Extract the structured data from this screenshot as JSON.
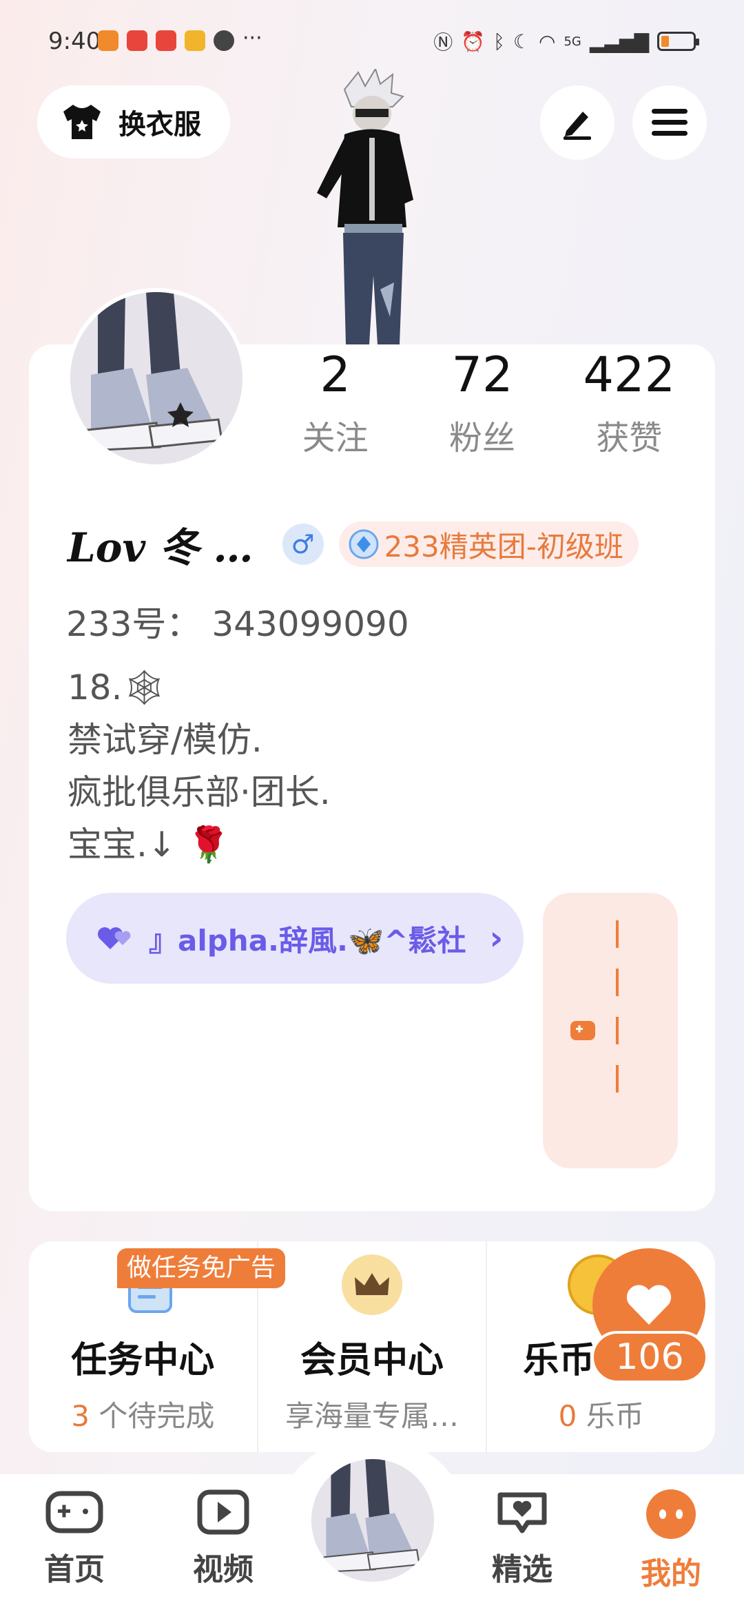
{
  "status": {
    "time": "9:40",
    "signal": "5G",
    "battery_level": 0.2,
    "app_icons": [
      "#f08a2a",
      "#e8453c",
      "#e8453c",
      "#f0b52a",
      "#444444"
    ]
  },
  "header": {
    "wardrobe_label": "换衣服",
    "edit_icon": "pen-icon",
    "menu_icon": "menu-icon"
  },
  "profile": {
    "stats": [
      {
        "value": "2",
        "label": "关注"
      },
      {
        "value": "72",
        "label": "粉丝"
      },
      {
        "value": "422",
        "label": "获赞"
      }
    ],
    "name": "Lov 冬 …",
    "gender": "♂",
    "badge": "233精英团-初级班",
    "id_label": "233号：",
    "id_value": "343099090",
    "bio": [
      "18.🕸",
      "禁试穿/模仿.",
      "疯批俱乐部·团长.",
      "宝宝.↓ 🌹"
    ],
    "club": "』alpha.辞風.🦋^鬆社",
    "club_arrow": "›"
  },
  "services": [
    {
      "title": "任务中心",
      "sub_prefix": "3",
      "sub_suffix": " 个待完成"
    },
    {
      "title": "会员中心",
      "sub_prefix": "",
      "sub_suffix": "享海量专属…"
    },
    {
      "title": "乐币",
      "sub_prefix": "0",
      "sub_suffix": " 乐币"
    }
  ],
  "task_tag": "做任务免广告",
  "like_count": "106",
  "nav": [
    {
      "label": "首页",
      "icon": "gamepad-icon"
    },
    {
      "label": "视频",
      "icon": "play-icon"
    },
    {
      "label": "精选",
      "icon": "heart-chat-icon"
    },
    {
      "label": "我的",
      "icon": "smile-icon"
    }
  ],
  "colors": {
    "accent": "#ef7d3a",
    "purple": "#6a5ce8"
  }
}
